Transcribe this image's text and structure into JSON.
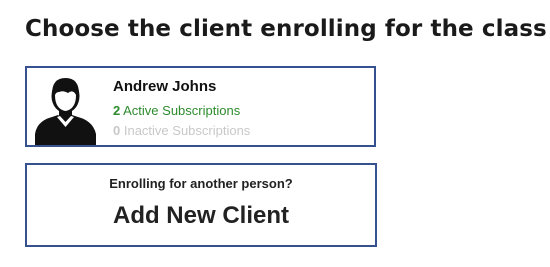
{
  "page": {
    "title": "Choose the client enrolling for the class"
  },
  "client": {
    "name": "Andrew Johns",
    "active_count": "2",
    "active_label": "Active Subscriptions",
    "inactive_count": "0",
    "inactive_label": "Inactive Subscriptions",
    "avatar_icon": "user-silhouette-icon"
  },
  "add_client": {
    "prompt": "Enrolling for another person?",
    "label": "Add New Client"
  },
  "colors": {
    "card_border": "#36518f",
    "active_text": "#2e8b2e",
    "inactive_text": "#c8c8c8"
  }
}
